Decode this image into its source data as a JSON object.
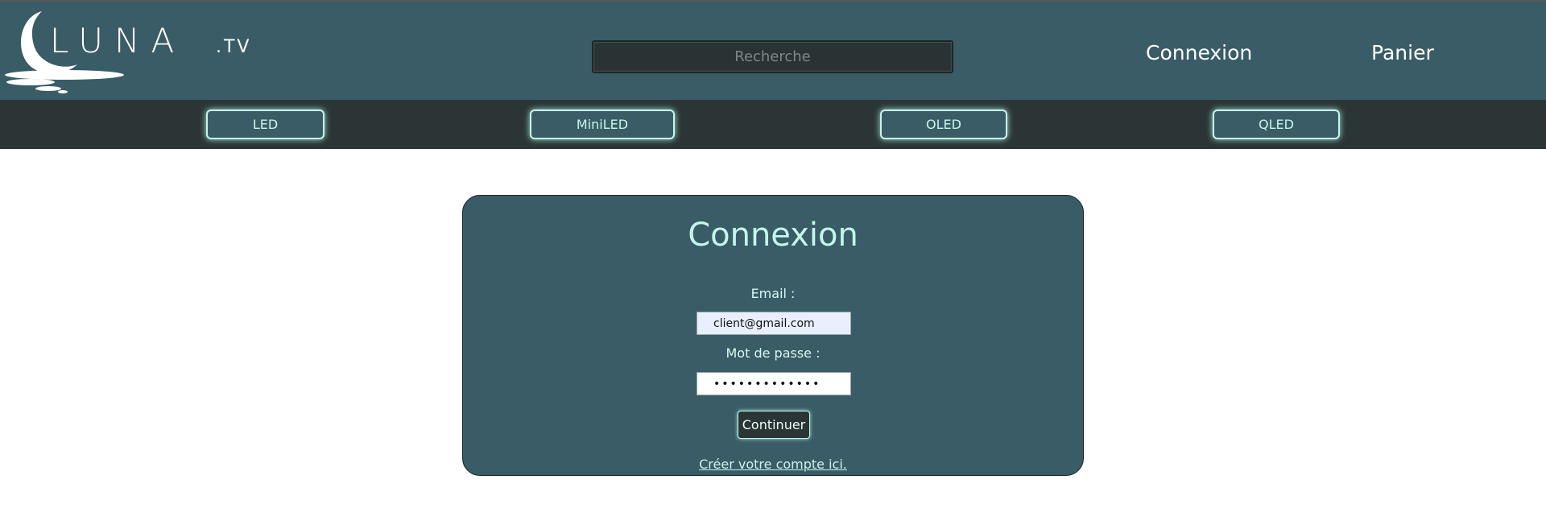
{
  "header": {
    "logo": {
      "wordmark": "LUNA",
      "suffix": ".TV",
      "icon": "crescent-moon-reflection-icon"
    },
    "search": {
      "placeholder": "Recherche",
      "value": ""
    },
    "nav": {
      "connexion": "Connexion",
      "panier": "Panier"
    }
  },
  "categories": [
    "LED",
    "MiniLED",
    "OLED",
    "QLED"
  ],
  "login": {
    "title": "Connexion",
    "email_label": "Email :",
    "email_value": "client@gmail.com",
    "password_label": "Mot de passe :",
    "password_value": "•••••••••••••",
    "continue_label": "Continuer",
    "create_account_link": "Créer votre compte ici."
  },
  "colors": {
    "header_bg": "#3a5c66",
    "category_bar_bg": "#2c3535",
    "accent_mint": "#c2f7eb",
    "page_bg": "#ffffff"
  }
}
